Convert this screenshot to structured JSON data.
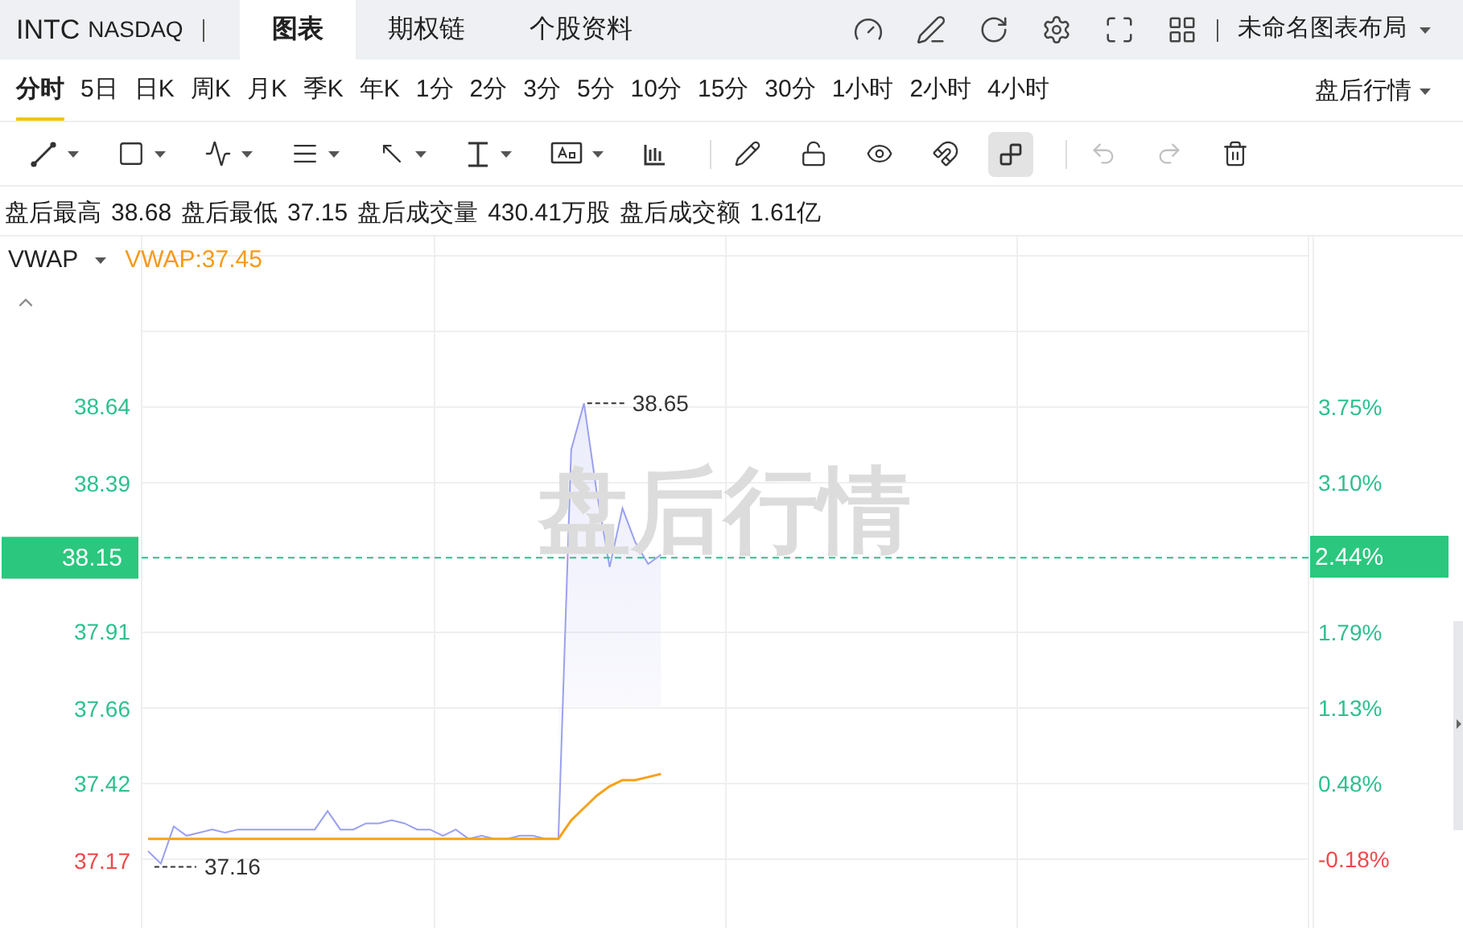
{
  "header": {
    "symbol": "INTC",
    "exchange": "NASDAQ",
    "tabs": [
      {
        "label": "图表",
        "selected": true
      },
      {
        "label": "期权链",
        "selected": false
      },
      {
        "label": "个股资料",
        "selected": false
      }
    ],
    "layout_menu": "未命名图表布局"
  },
  "periods": [
    {
      "label": "分时",
      "selected": true
    },
    {
      "label": "5日",
      "selected": false
    },
    {
      "label": "日K",
      "selected": false
    },
    {
      "label": "周K",
      "selected": false
    },
    {
      "label": "月K",
      "selected": false
    },
    {
      "label": "季K",
      "selected": false
    },
    {
      "label": "年K",
      "selected": false
    },
    {
      "label": "1分",
      "selected": false
    },
    {
      "label": "2分",
      "selected": false
    },
    {
      "label": "3分",
      "selected": false
    },
    {
      "label": "5分",
      "selected": false
    },
    {
      "label": "10分",
      "selected": false
    },
    {
      "label": "15分",
      "selected": false
    },
    {
      "label": "30分",
      "selected": false
    },
    {
      "label": "1小时",
      "selected": false
    },
    {
      "label": "2小时",
      "selected": false
    },
    {
      "label": "4小时",
      "selected": false
    }
  ],
  "session_menu": "盘后行情",
  "toolbar": [
    {
      "kind": "line",
      "dropdown": true,
      "selected": false,
      "disabled": false
    },
    {
      "kind": "rect",
      "dropdown": true,
      "selected": false,
      "disabled": false
    },
    {
      "kind": "wave",
      "dropdown": true,
      "selected": false,
      "disabled": false
    },
    {
      "kind": "fib",
      "dropdown": true,
      "selected": false,
      "disabled": false
    },
    {
      "kind": "arrow",
      "dropdown": true,
      "selected": false,
      "disabled": false
    },
    {
      "kind": "measure",
      "dropdown": true,
      "selected": false,
      "disabled": false
    },
    {
      "kind": "note",
      "dropdown": true,
      "selected": false,
      "disabled": false
    },
    {
      "kind": "bars",
      "dropdown": false,
      "selected": false,
      "disabled": false
    },
    {
      "kind": "pen",
      "dropdown": false,
      "selected": false,
      "disabled": false
    },
    {
      "kind": "lock",
      "dropdown": false,
      "selected": false,
      "disabled": false
    },
    {
      "kind": "eye",
      "dropdown": false,
      "selected": false,
      "disabled": false
    },
    {
      "kind": "magnet",
      "dropdown": false,
      "selected": false,
      "disabled": false
    },
    {
      "kind": "link",
      "dropdown": false,
      "selected": true,
      "disabled": false
    },
    {
      "kind": "undo",
      "dropdown": false,
      "selected": false,
      "disabled": true
    },
    {
      "kind": "redo",
      "dropdown": false,
      "selected": false,
      "disabled": true
    },
    {
      "kind": "trash",
      "dropdown": false,
      "selected": false,
      "disabled": false
    }
  ],
  "stats": [
    {
      "label": "盘后最高",
      "value": "38.68"
    },
    {
      "label": "盘后最低",
      "value": "37.15"
    },
    {
      "label": "盘后成交量",
      "value": "430.41万股"
    },
    {
      "label": "盘后成交额",
      "value": "1.61亿"
    }
  ],
  "indicator": {
    "reading": "VWAP:37.45"
  },
  "chart": {
    "background_label": "盘后行情",
    "tick_styles": [
      {
        "color": "#2dc08e"
      },
      {
        "color": "#2dc08e"
      },
      {
        "color": "#2dc08e"
      },
      {
        "color": "#2dc08e"
      },
      {
        "color": "#2dc08e"
      },
      {
        "color": "#f04848"
      }
    ],
    "chart_data": {
      "type": "line",
      "grid": true,
      "ylim": [
        36.95,
        39.19
      ],
      "categories": [
        null,
        null,
        null,
        null,
        null,
        null,
        null,
        null,
        null,
        null,
        null,
        null,
        null,
        null,
        null,
        null,
        null,
        null,
        null,
        null,
        null,
        null,
        null,
        null,
        null,
        null,
        null,
        null,
        null,
        null,
        null,
        null,
        null,
        null,
        null,
        null,
        null,
        null,
        null,
        null,
        null,
        null,
        null,
        null,
        null,
        null,
        null,
        null,
        null,
        null,
        null,
        null,
        null,
        null,
        null,
        null,
        null,
        null,
        null,
        null,
        null,
        null,
        null,
        null,
        null,
        null,
        null,
        null,
        null,
        null,
        null,
        null,
        null,
        null,
        null,
        null,
        null,
        null,
        null,
        null,
        null,
        null,
        null,
        null,
        null,
        null,
        null,
        null,
        null,
        null,
        null
      ],
      "yticks": [
        {
          "value": 38.64,
          "label": "38.64"
        },
        {
          "value": 38.39,
          "label": "38.39"
        },
        {
          "value": 37.91,
          "label": "37.91"
        },
        {
          "value": 37.66,
          "label": "37.66"
        },
        {
          "value": 37.42,
          "label": "37.42"
        },
        {
          "value": 37.17,
          "label": "37.17"
        }
      ],
      "ref_lines": [
        {
          "axis": "y",
          "value": 38.15,
          "label": "38.15",
          "color": "#2dc08e"
        }
      ],
      "series": [
        {
          "color": "#9aa0ee",
          "values": [
            37.2,
            37.16,
            37.28,
            37.25,
            37.26,
            37.27,
            37.26,
            37.27,
            37.27,
            37.27,
            37.27,
            37.27,
            37.27,
            37.27,
            37.33,
            37.27,
            37.27,
            37.29,
            37.29,
            37.3,
            37.29,
            37.27,
            37.27,
            37.25,
            37.27,
            37.24,
            37.25,
            37.24,
            37.24,
            37.25,
            37.25,
            37.24,
            37.24,
            38.5,
            38.65,
            38.36,
            38.12,
            38.31,
            38.2,
            38.13,
            38.16,
            null,
            null,
            null,
            null,
            null,
            null,
            null,
            null,
            null,
            null,
            null,
            null,
            null,
            null,
            null,
            null,
            null,
            null,
            null,
            null,
            null,
            null,
            null,
            null,
            null,
            null,
            null,
            null,
            null,
            null,
            null,
            null,
            null,
            null,
            null,
            null,
            null,
            null,
            null,
            null,
            null,
            null,
            null,
            null,
            null,
            null,
            null,
            null,
            null,
            null
          ]
        },
        {
          "name": "VWAP",
          "color": "#f7a11a",
          "values": [
            37.24,
            37.24,
            37.24,
            37.24,
            37.24,
            37.24,
            37.24,
            37.24,
            37.24,
            37.24,
            37.24,
            37.24,
            37.24,
            37.24,
            37.24,
            37.24,
            37.24,
            37.24,
            37.24,
            37.24,
            37.24,
            37.24,
            37.24,
            37.24,
            37.24,
            37.24,
            37.24,
            37.24,
            37.24,
            37.24,
            37.24,
            37.24,
            37.24,
            37.3,
            37.34,
            37.38,
            37.41,
            37.43,
            37.43,
            37.44,
            37.45,
            null,
            null,
            null,
            null,
            null,
            null,
            null,
            null,
            null,
            null,
            null,
            null,
            null,
            null,
            null,
            null,
            null,
            null,
            null,
            null,
            null,
            null,
            null,
            null,
            null,
            null,
            null,
            null,
            null,
            null,
            null,
            null,
            null,
            null,
            null,
            null,
            null,
            null,
            null,
            null,
            null,
            null,
            null,
            null,
            null,
            null,
            null,
            null,
            null,
            null
          ]
        }
      ]
    },
    "percent_labels": [
      {
        "text": "3.75%",
        "color": "#2dc08e"
      },
      {
        "text": "3.10%",
        "color": "#2dc08e"
      },
      {
        "text": "1.79%",
        "color": "#2dc08e"
      },
      {
        "text": "1.13%",
        "color": "#2dc08e"
      },
      {
        "text": "0.48%",
        "color": "#2dc08e"
      },
      {
        "text": "-0.18%",
        "color": "#f04848"
      }
    ],
    "current_percent": "2.44%",
    "high_marker": "38.65",
    "low_marker": "37.16"
  }
}
